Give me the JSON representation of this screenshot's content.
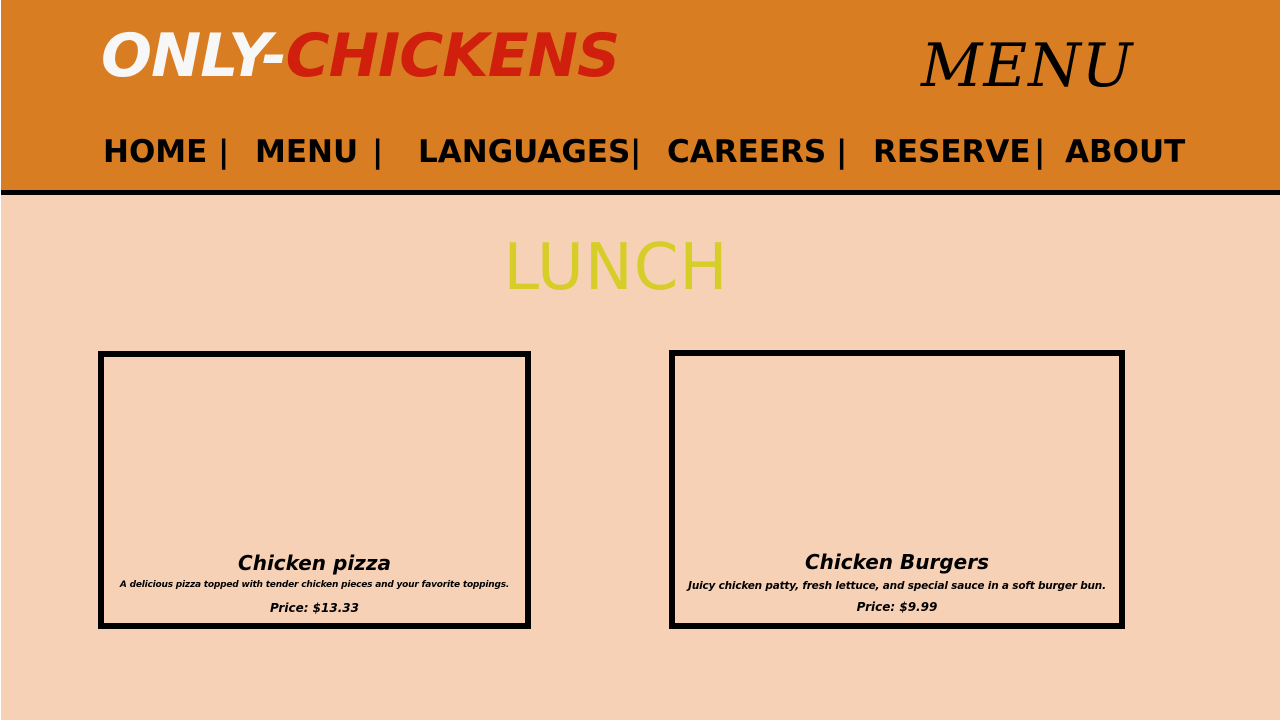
{
  "header": {
    "logo_part1": "ONLY-",
    "logo_part2": "CHICKENS",
    "page_title": "MENU",
    "background_color": "#d97d22",
    "logo_accent_color": "#d11f0d"
  },
  "nav": {
    "items": [
      {
        "label": "HOME"
      },
      {
        "label": "MENU"
      },
      {
        "label": "LANGUAGES"
      },
      {
        "label": "CAREERS"
      },
      {
        "label": "RESERVE"
      },
      {
        "label": "ABOUT"
      }
    ],
    "separator": "|"
  },
  "section": {
    "title": "LUNCH",
    "title_color": "#d6cd28",
    "background_color": "#f7d1b6"
  },
  "menu_items": [
    {
      "name": "Chicken pizza",
      "description": "A delicious pizza topped with tender chicken pieces and your favorite toppings.",
      "price": "Price: $13.33"
    },
    {
      "name": "Chicken Burgers",
      "description": "Juicy chicken patty, fresh lettuce, and special sauce in a soft burger bun.",
      "price": "Price: $9.99"
    }
  ]
}
